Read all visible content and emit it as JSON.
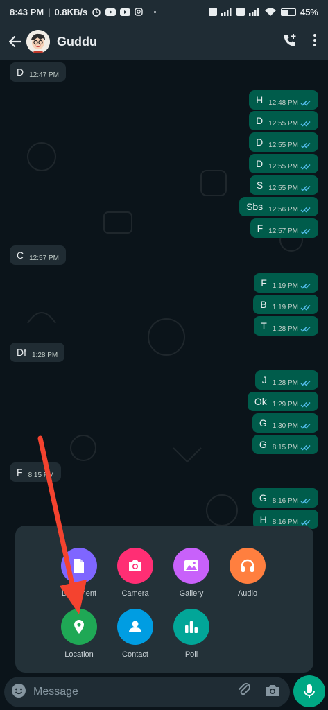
{
  "status_bar": {
    "time": "8:43 PM",
    "speed": "0.8KB/s",
    "battery": "45%",
    "battery_level": 0.45
  },
  "header": {
    "contact_name": "Guddu"
  },
  "messages": [
    {
      "dir": "in",
      "text": "D",
      "time": "12:47 PM"
    },
    {
      "dir": "out",
      "text": "H",
      "time": "12:48 PM"
    },
    {
      "dir": "out",
      "text": "D",
      "time": "12:55 PM"
    },
    {
      "dir": "out",
      "text": "D",
      "time": "12:55 PM"
    },
    {
      "dir": "out",
      "text": "D",
      "time": "12:55 PM"
    },
    {
      "dir": "out",
      "text": "S",
      "time": "12:55 PM"
    },
    {
      "dir": "out",
      "text": "Sbs",
      "time": "12:56 PM"
    },
    {
      "dir": "out",
      "text": "F",
      "time": "12:57 PM"
    },
    {
      "dir": "in",
      "text": "C",
      "time": "12:57 PM"
    },
    {
      "dir": "out",
      "text": "F",
      "time": "1:19 PM"
    },
    {
      "dir": "out",
      "text": "B",
      "time": "1:19 PM"
    },
    {
      "dir": "out",
      "text": "T",
      "time": "1:28 PM"
    },
    {
      "dir": "in",
      "text": "Df",
      "time": "1:28 PM"
    },
    {
      "dir": "out",
      "text": "J",
      "time": "1:28 PM"
    },
    {
      "dir": "out",
      "text": "Ok",
      "time": "1:29 PM"
    },
    {
      "dir": "out",
      "text": "G",
      "time": "1:30 PM"
    },
    {
      "dir": "out",
      "text": "G",
      "time": "8:15 PM"
    },
    {
      "dir": "in",
      "text": "F",
      "time": "8:15 PM"
    },
    {
      "dir": "out",
      "text": "G",
      "time": "8:16 PM"
    },
    {
      "dir": "out",
      "text": "H",
      "time": "8:16 PM"
    }
  ],
  "attach_options": [
    {
      "label": "Document",
      "icon": "document-icon",
      "color": "#7f66ff"
    },
    {
      "label": "Camera",
      "icon": "camera-icon",
      "color": "#ff2e74"
    },
    {
      "label": "Gallery",
      "icon": "gallery-icon",
      "color": "#c861fa"
    },
    {
      "label": "Audio",
      "icon": "headphones-icon",
      "color": "#ff7f3f"
    },
    {
      "label": "Location",
      "icon": "location-pin-icon",
      "color": "#1fa855"
    },
    {
      "label": "Contact",
      "icon": "person-icon",
      "color": "#009de2"
    },
    {
      "label": "Poll",
      "icon": "poll-icon",
      "color": "#02a698"
    }
  ],
  "input": {
    "placeholder": "Message"
  },
  "colors": {
    "outgoing_bubble": "#005c4b",
    "incoming_bubble": "#202c33",
    "accent": "#00a884",
    "read_ticks": "#53bdeb",
    "annotation_arrow": "#f4432f"
  }
}
